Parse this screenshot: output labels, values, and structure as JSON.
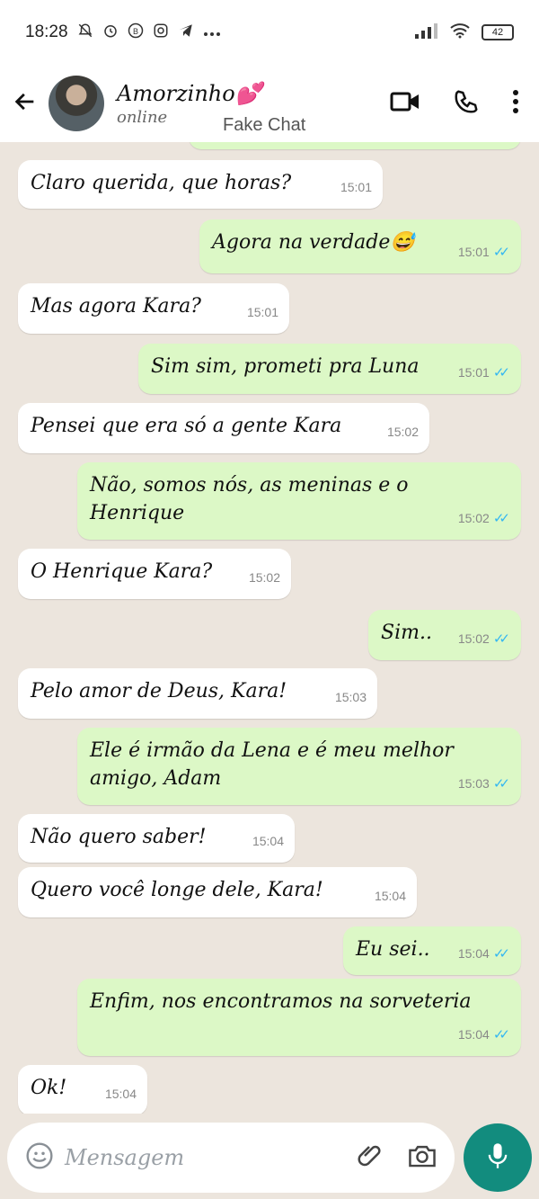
{
  "status_bar": {
    "time": "18:28",
    "battery": "42"
  },
  "header": {
    "name": "Amorzinho💕",
    "status": "online",
    "watermark": "Fake Chat"
  },
  "messages": [
    {
      "dir": "in",
      "text": "Claro querida, que horas?",
      "time": "15:01"
    },
    {
      "dir": "out",
      "text": "Agora na verdade😅",
      "time": "15:01"
    },
    {
      "dir": "in",
      "text": "Mas agora Kara?",
      "time": "15:01"
    },
    {
      "dir": "out",
      "text": "Sim sim, prometi pra Luna",
      "time": "15:01"
    },
    {
      "dir": "in",
      "text": "Pensei que era só a gente Kara",
      "time": "15:02"
    },
    {
      "dir": "out",
      "text": "Não, somos nós, as meninas e o Henrique",
      "time": "15:02"
    },
    {
      "dir": "in",
      "text": "O Henrique Kara?",
      "time": "15:02"
    },
    {
      "dir": "out",
      "text": "Sim..",
      "time": "15:02"
    },
    {
      "dir": "in",
      "text": "Pelo amor de Deus, Kara!",
      "time": "15:03"
    },
    {
      "dir": "out",
      "text": "Ele é irmão da Lena e é meu melhor amigo, Adam",
      "time": "15:03"
    },
    {
      "dir": "in",
      "text": "Não quero saber!",
      "time": "15:04"
    },
    {
      "dir": "in",
      "text": "Quero você longe dele, Kara!",
      "time": "15:04"
    },
    {
      "dir": "out",
      "text": "Eu sei..",
      "time": "15:04"
    },
    {
      "dir": "out",
      "text": "Enfim, nos encontramos na sorveteria",
      "time": "15:04"
    },
    {
      "dir": "in",
      "text": "Ok!",
      "time": "15:04"
    }
  ],
  "input": {
    "placeholder": "Mensagem"
  },
  "colors": {
    "incoming": "#ffffff",
    "outgoing": "#dcf8c6",
    "accent": "#128c7e",
    "read_ticks": "#34b7f1"
  },
  "icons": [
    "mute-icon",
    "alarm-icon",
    "b-icon",
    "instagram-icon",
    "telegram-icon",
    "more-icon",
    "signal-icon",
    "wifi-icon",
    "battery-icon",
    "back-arrow-icon",
    "video-call-icon",
    "phone-icon",
    "menu-icon",
    "emoji-icon",
    "attach-icon",
    "camera-icon",
    "mic-icon"
  ]
}
